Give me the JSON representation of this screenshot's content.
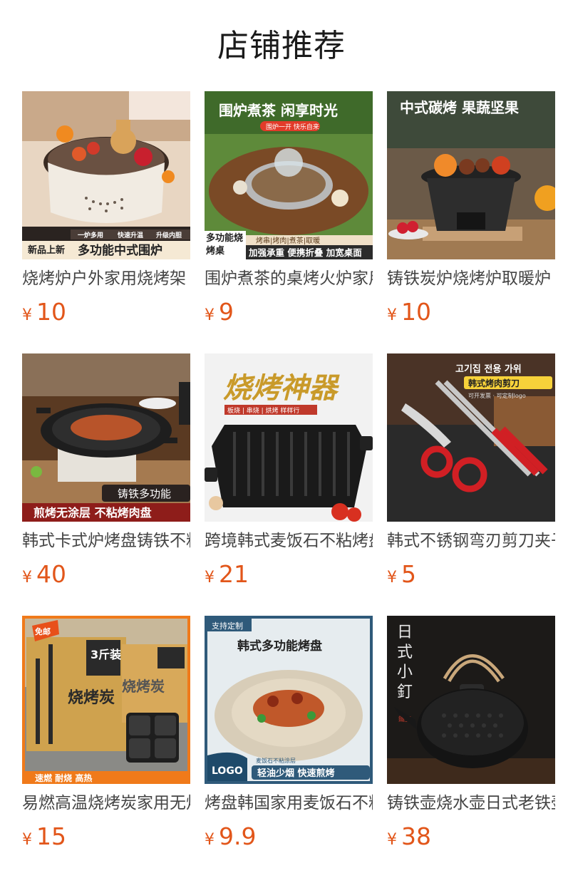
{
  "page": {
    "title": "店铺推荐"
  },
  "currency_symbol": "¥",
  "products": [
    {
      "name": "烧烤炉户外家用烧烤架",
      "price": "10",
      "img": {
        "top": "",
        "sub": "",
        "badge": "新品上新",
        "bottom": "多功能中式围炉",
        "chips": [
          "一炉多用",
          "快速升温",
          "升级内胆"
        ]
      }
    },
    {
      "name": "围炉煮茶的桌烤火炉家用",
      "price": "9",
      "img": {
        "top": "围炉煮茶 闲享时光",
        "sub": "围炉一开 快乐自来",
        "badge": "多功能烧烤桌",
        "bottom": "加强承重 便携折叠 加宽桌面",
        "chips": [
          "烤串|烤肉|煮茶|取暖"
        ]
      }
    },
    {
      "name": "铸铁炭炉烧烤炉取暖炉",
      "price": "10",
      "img": {
        "top": "中式碳烤 果蔬坚果",
        "sub": "",
        "badge": "",
        "bottom": "",
        "chips": []
      }
    },
    {
      "name": "韩式卡式炉烤盘铸铁不粘",
      "price": "40",
      "img": {
        "top": "",
        "sub": "",
        "badge": "铸铁多功能",
        "bottom": "煎烤无涂层 不粘烤肉盘",
        "chips": []
      }
    },
    {
      "name": "跨境韩式麦饭石不粘烤盘",
      "price": "21",
      "img": {
        "top": "烧烤神器",
        "sub": "板烧 | 串烧 | 烘烤  样样行",
        "badge": "",
        "bottom": "",
        "chips": []
      }
    },
    {
      "name": "韩式不锈钢弯刃剪刀夹子",
      "price": "5",
      "img": {
        "top": "고기집 전용 가위",
        "sub": "韩式烤肉剪刀",
        "badge": "可开发票 · 可定制logo",
        "bottom": "",
        "chips": []
      }
    },
    {
      "name": "易燃高温烧烤炭家用无烟",
      "price": "15",
      "img": {
        "top": "免邮",
        "sub": "3斤装",
        "badge": "烧烤炭",
        "bottom": "速燃    耐烧    高热",
        "chips": []
      }
    },
    {
      "name": "烤盘韩国家用麦饭石不粘",
      "price": "9.9",
      "img": {
        "top": "支持定制",
        "sub": "韩式多功能烤盘",
        "badge": "LOGO",
        "bottom": "轻油少烟  快速煎烤",
        "chips": [
          "麦饭石不粘涂层"
        ]
      }
    },
    {
      "name": "铸铁壶烧水壶日式老铁壶",
      "price": "38",
      "img": {
        "top": "日式小釘",
        "sub": "鐵壺",
        "badge": "",
        "bottom": "",
        "chips": []
      }
    }
  ],
  "colors": {
    "price": "#e2561a",
    "title": "#1a1a1a",
    "name": "#444444"
  }
}
